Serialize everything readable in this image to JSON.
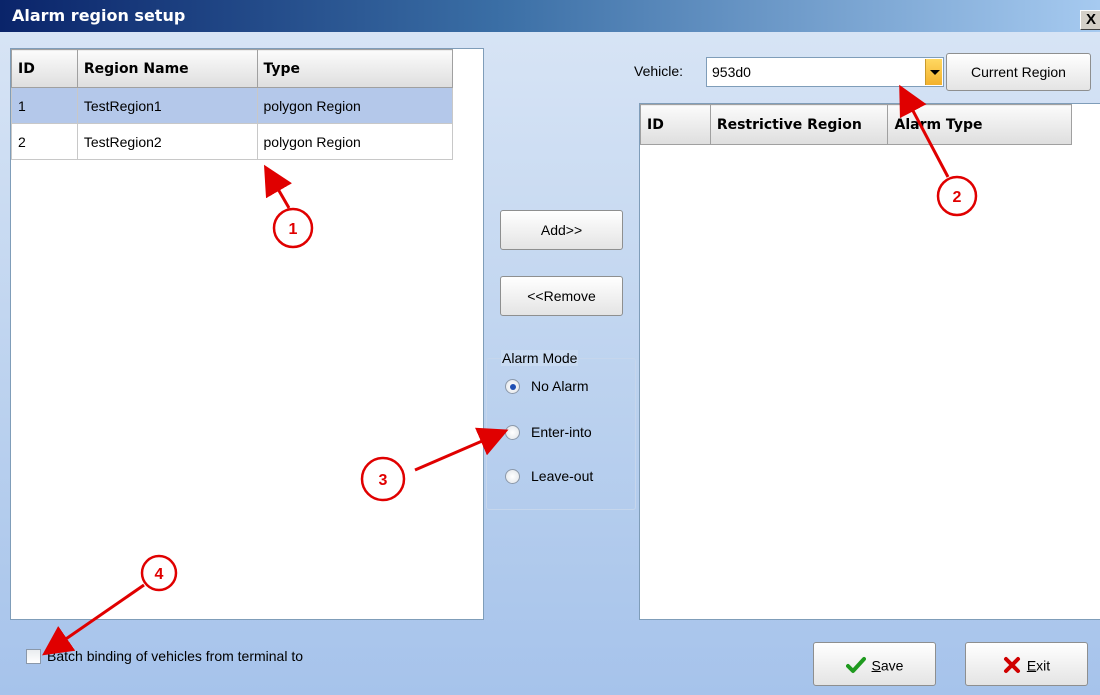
{
  "window": {
    "title": "Alarm region setup",
    "close_label": "X"
  },
  "left_grid": {
    "headers": [
      "ID",
      "Region Name",
      "Type"
    ],
    "rows": [
      {
        "id": "1",
        "name": "TestRegion1",
        "type": "polygon Region"
      },
      {
        "id": "2",
        "name": "TestRegion2",
        "type": "polygon Region"
      }
    ]
  },
  "middle": {
    "add_label": "Add>>",
    "remove_label": "<<Remove",
    "alarm_mode": {
      "legend": "Alarm Mode",
      "options": [
        "No Alarm",
        "Enter-into",
        "Leave-out"
      ],
      "selected": "No Alarm"
    }
  },
  "right": {
    "vehicle_label": "Vehicle:",
    "vehicle_value": "953d0",
    "current_region_label": "Current Region",
    "grid_headers": [
      "ID",
      "Restrictive Region",
      "Alarm Type"
    ]
  },
  "bottom": {
    "batch_label": "Batch binding of vehicles from terminal to",
    "batch_checked": false,
    "save": {
      "mnemonic": "S",
      "rest": "ave"
    },
    "exit": {
      "mnemonic": "E",
      "rest": "xit"
    }
  },
  "annotations": [
    "1",
    "2",
    "3",
    "4"
  ],
  "colors": {
    "annotation_red": "#e00000",
    "selected_row": "#b4c8ea",
    "save_check_green": "#1f9a1f",
    "exit_x_red": "#d00000",
    "dropdown_accent": "#f3b12c"
  }
}
